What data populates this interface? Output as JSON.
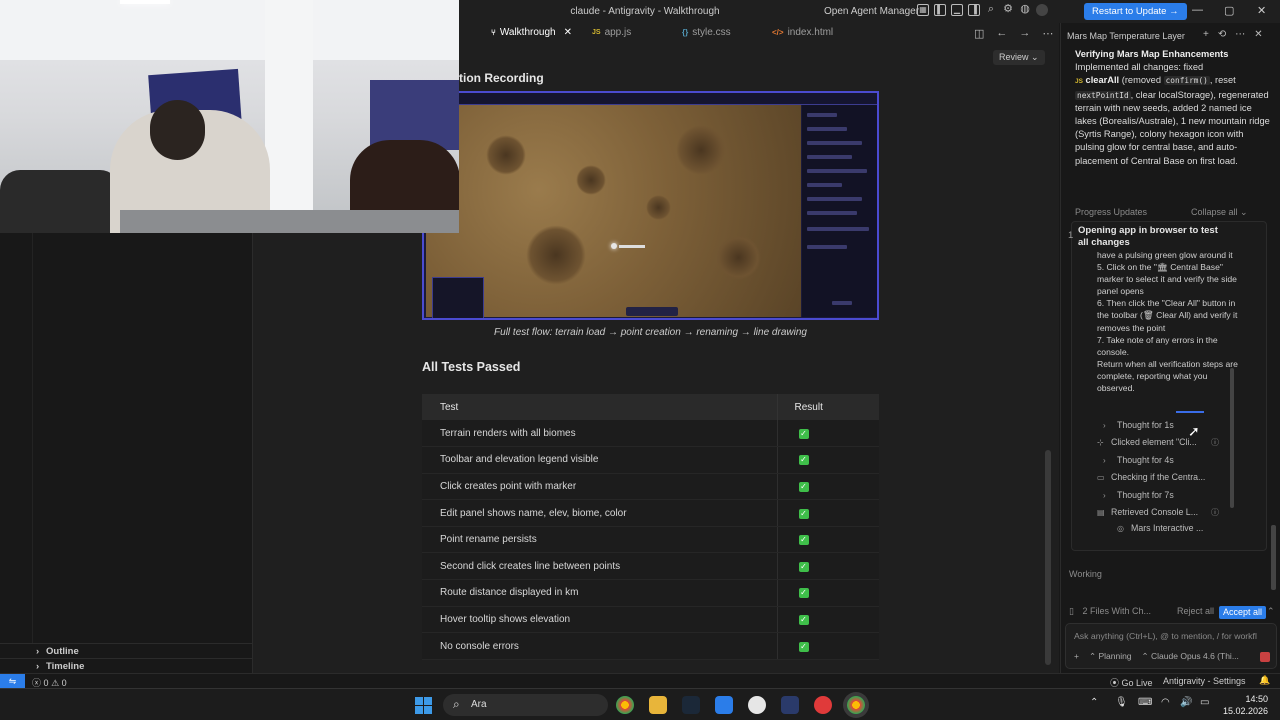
{
  "window": {
    "title": "claude - Antigravity - Walkthrough",
    "open_agent_manager": "Open Agent Manager",
    "restart_button": "Restart to Update →"
  },
  "tabs": [
    {
      "label": "Walkthrough",
      "icon": "walkthrough-icon",
      "active": true
    },
    {
      "label": "app.js",
      "icon": "js-icon"
    },
    {
      "label": "style.css",
      "icon": "css-icon"
    },
    {
      "label": "index.html",
      "icon": "html-icon"
    }
  ],
  "editor": {
    "review_button": "Review",
    "section_title": "tion Recording",
    "caption": "Full test flow: terrain load → point creation → renaming → line drawing",
    "tests_heading": "All Tests Passed",
    "table": {
      "headers": [
        "Test",
        "Result"
      ],
      "rows": [
        "Terrain renders with all biomes",
        "Toolbar and elevation legend visible",
        "Click creates point with marker",
        "Edit panel shows name, elev, biome, color",
        "Point rename persists",
        "Second click creates line between points",
        "Route distance displayed in km",
        "Hover tooltip shows elevation",
        "No console errors"
      ],
      "result_icon": "check-icon"
    }
  },
  "sidebar": {
    "outline": "Outline",
    "timeline": "Timeline"
  },
  "agent_panel": {
    "header": "Mars Map Temperature Layer",
    "summary": {
      "title": "Verifying Mars Map Enhancements",
      "intro": "Implemented all changes: fixed",
      "clearAll": "clearAll",
      "removed_pre": "(removed",
      "confirm_code": "confirm()",
      "reset_text": ", reset",
      "nextPointId": "nextPointId",
      "rest": ", clear localStorage), regenerated terrain with new seeds, added 2 named ice lakes (Borealis/Australe), 1 new mountain ridge (Syrtis Range), colony hexagon icon with pulsing glow for central base, and auto-placement of Central Base on first load."
    },
    "progress_updates": "Progress Updates",
    "collapse_all": "Collapse all",
    "task_number": "1",
    "task_title": "Opening app in browser to test all changes",
    "task_lines": [
      "have a pulsing green glow around it",
      "5. Click on the \"🏛 Central Base\" marker to select it and verify the side panel opens",
      "6. Then click the \"Clear All\" button in the toolbar (🗑 Clear All) and verify it removes the point",
      "7. Take note of any errors in the console.",
      "Return when all verification steps are complete, reporting what you observed."
    ],
    "steps": [
      {
        "label": "Thought for 1s",
        "icon": "chevron-right-icon"
      },
      {
        "label": "Clicked element \"Cli...",
        "icon": "cursor-click-icon",
        "info": true
      },
      {
        "label": "Thought for 4s",
        "icon": "chevron-right-icon"
      },
      {
        "label": "Checking if the Centra...",
        "icon": "browser-icon"
      },
      {
        "label": "Thought for 7s",
        "icon": "chevron-right-icon"
      },
      {
        "label": "Retrieved Console L...",
        "icon": "console-icon",
        "info": true
      },
      {
        "label": "Mars Interactive ...",
        "icon": "globe-icon"
      }
    ],
    "working": "Working",
    "files_changed": "2 Files With Ch...",
    "reject_all": "Reject all",
    "accept_all": "Accept all",
    "input_placeholder": "Ask anything (Ctrl+L), @ to mention, / for workfl",
    "mode": "Planning",
    "model": "Claude Opus 4.6 (Thi..."
  },
  "statusbar": {
    "remote_icon": "remote-icon",
    "errors": "0",
    "warnings": "0",
    "go_live": "Go Live",
    "settings": "Antigravity - Settings"
  },
  "taskbar": {
    "search_label": "Ara",
    "time": "14:50",
    "date": "15.02.2026"
  },
  "colors": {
    "accent": "#2b7de9",
    "check": "#3fbf4a",
    "screenshot_border": "#4b4bd1"
  }
}
